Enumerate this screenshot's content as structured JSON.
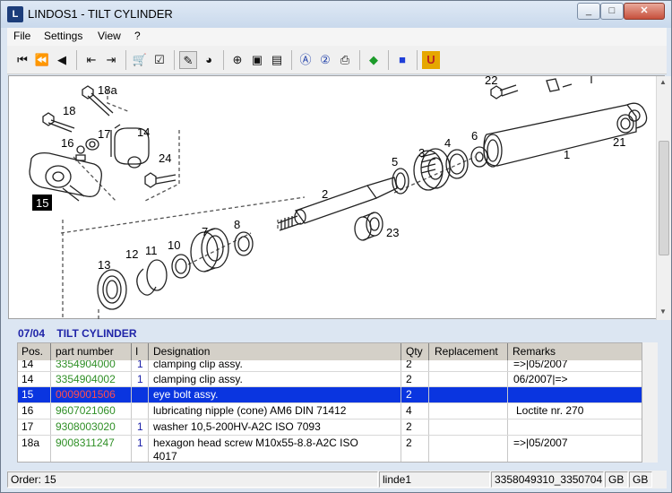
{
  "window": {
    "title": "LINDOS1 - TILT CYLINDER",
    "app_icon": "lindos-logo"
  },
  "window_controls": {
    "minimize": "_",
    "maximize": "□",
    "close": "✕"
  },
  "menu": [
    "File",
    "Settings",
    "View",
    "?"
  ],
  "toolbar_icons": [
    "first-page-icon",
    "fast-back-icon",
    "back-icon",
    "prev-list-icon",
    "next-list-icon",
    "cart-icon",
    "checklist-icon",
    "pencil-icon",
    "globe-icon",
    "zoom-in-icon",
    "page-icon",
    "page-fit-icon",
    "info-a-icon",
    "help-icon",
    "print-icon",
    "book-icon",
    "blue-square-icon",
    "u-logo-icon"
  ],
  "drawing": {
    "callouts": [
      "18a",
      "18",
      "16",
      "17",
      "14",
      "24",
      "15",
      "22",
      "1",
      "21",
      "6",
      "4",
      "3",
      "5",
      "2",
      "8",
      "7",
      "10",
      "11",
      "12",
      "13",
      "23"
    ],
    "highlighted_callout": "15"
  },
  "section": {
    "number": "07/04",
    "title": "TILT CYLINDER"
  },
  "table": {
    "columns": [
      "Pos.",
      "part number",
      "I",
      "Designation",
      "Qty",
      "Replacement",
      "Remarks"
    ],
    "rows": [
      {
        "pos": "14",
        "part": "3354904000",
        "ind": "1",
        "designation": "clamping clip assy.",
        "qty": "2",
        "replacement": "",
        "remarks": "=>|05/2007"
      },
      {
        "pos": "14",
        "part": "3354904002",
        "ind": "1",
        "designation": "clamping clip assy.",
        "qty": "2",
        "replacement": "",
        "remarks": "06/2007|=>"
      },
      {
        "pos": "15",
        "part": "0009001506",
        "ind": "",
        "designation": "eye bolt assy.",
        "qty": "2",
        "replacement": "",
        "remarks": "",
        "selected": true
      },
      {
        "pos": "16",
        "part": "9607021060",
        "ind": "",
        "designation": "lubricating nipple (cone) AM6  DIN 71412",
        "qty": "4",
        "replacement": "",
        "remarks": "Loctite nr. 270"
      },
      {
        "pos": "17",
        "part": "9308003020",
        "ind": "1",
        "designation": "washer 10,5-200HV-A2C  ISO 7093",
        "qty": "2",
        "replacement": "",
        "remarks": ""
      },
      {
        "pos": "18a",
        "part": "9008311247",
        "ind": "1",
        "designation": "hexagon head screw M10x55-8.8-A2C  ISO",
        "designation2": "4017",
        "qty": "2",
        "replacement": "",
        "remarks": "=>|05/2007"
      }
    ]
  },
  "status": {
    "order": "Order: 15",
    "user": "linde1",
    "codes": "3358049310_3350704",
    "lang1": "GB",
    "lang2": "GB"
  },
  "colors": {
    "selected_row": "#0a35e0",
    "part_number": "#2f8f26",
    "section_title": "#1f24a8"
  }
}
